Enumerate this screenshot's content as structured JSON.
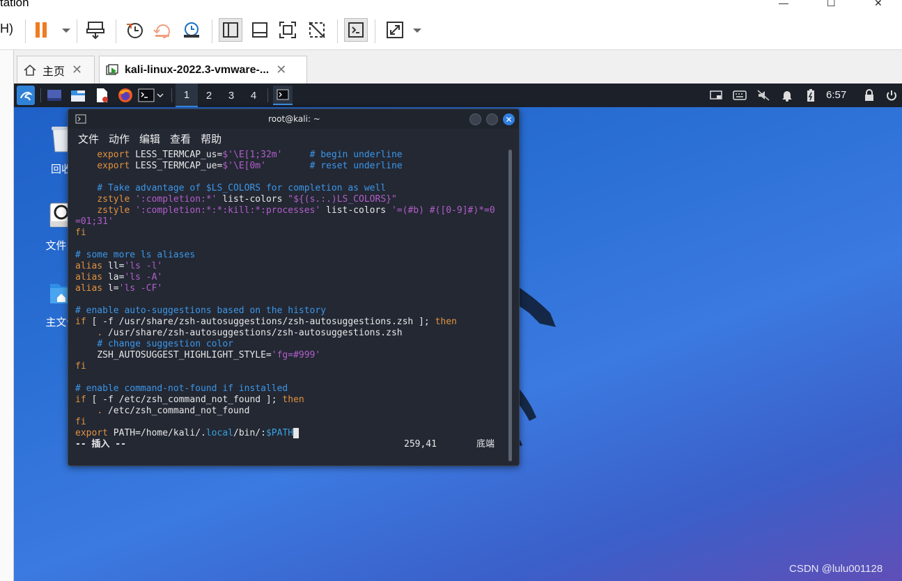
{
  "host": {
    "title_fragment": "tation",
    "menu_fragment": "H)",
    "tabs": [
      {
        "label": "主页"
      },
      {
        "label": "kali-linux-2022.3-vmware-..."
      }
    ]
  },
  "guest": {
    "workspaces": [
      "1",
      "2",
      "3",
      "4"
    ],
    "active_workspace": "1",
    "clock": "6:57",
    "desktop_icons": [
      {
        "label": "回收"
      },
      {
        "label": "文件系"
      },
      {
        "label": "主文件"
      }
    ]
  },
  "terminal": {
    "title": "root@kali: ~",
    "menu": [
      "文件",
      "动作",
      "编辑",
      "查看",
      "帮助"
    ],
    "lines": [
      [
        {
          "t": "    "
        },
        {
          "t": "export",
          "c": "kw"
        },
        {
          "t": " LESS_TERMCAP_us="
        },
        {
          "t": "$'\\E[1;32m'",
          "c": "str"
        },
        {
          "t": "     "
        },
        {
          "t": "# begin underline",
          "c": "cm"
        }
      ],
      [
        {
          "t": "    "
        },
        {
          "t": "export",
          "c": "kw"
        },
        {
          "t": " LESS_TERMCAP_ue="
        },
        {
          "t": "$'\\E[0m'",
          "c": "str"
        },
        {
          "t": "        "
        },
        {
          "t": "# reset underline",
          "c": "cm"
        }
      ],
      [
        {
          "t": ""
        }
      ],
      [
        {
          "t": "    "
        },
        {
          "t": "# Take advantage of $LS_COLORS for completion as well",
          "c": "cm"
        }
      ],
      [
        {
          "t": "    "
        },
        {
          "t": "zstyle",
          "c": "kw"
        },
        {
          "t": " "
        },
        {
          "t": "':completion:*'",
          "c": "str"
        },
        {
          "t": " list-colors "
        },
        {
          "t": "\"${(s.:.)LS_COLORS}\"",
          "c": "str"
        }
      ],
      [
        {
          "t": "    "
        },
        {
          "t": "zstyle",
          "c": "kw"
        },
        {
          "t": " "
        },
        {
          "t": "':completion:*:*:kill:*:processes'",
          "c": "str"
        },
        {
          "t": " list-colors "
        },
        {
          "t": "'=(#b) #([0-9]#)*=0",
          "c": "str"
        }
      ],
      [
        {
          "t": "=01;31'",
          "c": "str"
        }
      ],
      [
        {
          "t": "fi",
          "c": "kw"
        }
      ],
      [
        {
          "t": ""
        }
      ],
      [
        {
          "t": "# some more ls aliases",
          "c": "cm"
        }
      ],
      [
        {
          "t": "alias",
          "c": "kw"
        },
        {
          "t": " ll="
        },
        {
          "t": "'ls -l'",
          "c": "str"
        }
      ],
      [
        {
          "t": "alias",
          "c": "kw"
        },
        {
          "t": " la="
        },
        {
          "t": "'ls -A'",
          "c": "str"
        }
      ],
      [
        {
          "t": "alias",
          "c": "kw"
        },
        {
          "t": " l="
        },
        {
          "t": "'ls -CF'",
          "c": "str"
        }
      ],
      [
        {
          "t": ""
        }
      ],
      [
        {
          "t": "# enable auto-suggestions based on the history",
          "c": "cm"
        }
      ],
      [
        {
          "t": "if",
          "c": "kw"
        },
        {
          "t": " [ -f /usr/share/zsh-autosuggestions/zsh-autosuggestions.zsh ]; "
        },
        {
          "t": "then",
          "c": "kw"
        }
      ],
      [
        {
          "t": "    "
        },
        {
          "t": ".",
          "c": "kw"
        },
        {
          "t": " /usr/share/zsh-autosuggestions/zsh-autosuggestions.zsh"
        }
      ],
      [
        {
          "t": "    "
        },
        {
          "t": "# change suggestion color",
          "c": "cm"
        }
      ],
      [
        {
          "t": "    ZSH_AUTOSUGGEST_HIGHLIGHT_STYLE="
        },
        {
          "t": "'fg=#999'",
          "c": "str"
        }
      ],
      [
        {
          "t": "fi",
          "c": "kw"
        }
      ],
      [
        {
          "t": ""
        }
      ],
      [
        {
          "t": "# enable command-not-found if installed",
          "c": "cm"
        }
      ],
      [
        {
          "t": "if",
          "c": "kw"
        },
        {
          "t": " [ -f /etc/zsh_command_not_found ]; "
        },
        {
          "t": "then",
          "c": "kw"
        }
      ],
      [
        {
          "t": "    "
        },
        {
          "t": ".",
          "c": "kw"
        },
        {
          "t": " /etc/zsh_command_not_found"
        }
      ],
      [
        {
          "t": "fi",
          "c": "kw"
        }
      ],
      [
        {
          "t": "export",
          "c": "kw"
        },
        {
          "t": " PATH=/home/kali/."
        },
        {
          "t": "local",
          "c": "var"
        },
        {
          "t": "/bin/:"
        },
        {
          "t": "$PATH",
          "c": "var"
        },
        {
          "t": " ",
          "c": "cursor"
        }
      ]
    ],
    "status_mode": "-- 插入 --",
    "status_pos": "259,41",
    "status_scroll": "底端"
  },
  "watermark": "CSDN @lulu001128",
  "colors": {
    "keyword": "#e3923f",
    "comment": "#3d96e8",
    "string": "#b25ec9",
    "terminal_bg": "#232833",
    "panel_bg": "#1b2029",
    "close_button": "#2f7fe0"
  }
}
